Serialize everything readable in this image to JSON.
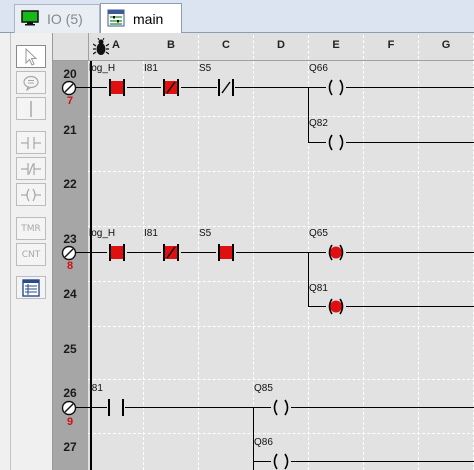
{
  "tabs": [
    {
      "label": "IO (5)",
      "icon": "monitor-icon",
      "active": false
    },
    {
      "label": "main",
      "icon": "ladder-diagram-icon",
      "active": true
    }
  ],
  "toolbox": [
    {
      "name": "pointer-tool",
      "icon": "arrow-pointer-icon"
    },
    {
      "name": "comment-tool",
      "icon": "speech-bubble-icon"
    },
    {
      "name": "wire-tool",
      "icon": "vertical-line-icon"
    },
    {
      "name": "contact-no-tool",
      "icon": "normally-open-contact-icon"
    },
    {
      "name": "contact-nc-tool",
      "icon": "normally-closed-contact-icon"
    },
    {
      "name": "coil-tool",
      "icon": "coil-icon"
    },
    {
      "name": "timer-tool",
      "label": "TMR"
    },
    {
      "name": "counter-tool",
      "label": "CNT"
    },
    {
      "name": "table-tool",
      "icon": "table-icon"
    }
  ],
  "columns": [
    "A",
    "B",
    "C",
    "D",
    "E",
    "F",
    "G"
  ],
  "bug_icon": "bug-icon",
  "rungs": [
    {
      "number": "20",
      "sub": "7",
      "timer_icon": "clock-icon"
    },
    {
      "number": "21"
    },
    {
      "number": "22"
    },
    {
      "number": "23",
      "sub": "8",
      "timer_icon": "clock-icon"
    },
    {
      "number": "24"
    },
    {
      "number": "25"
    },
    {
      "number": "26",
      "sub": "9",
      "timer_icon": "clock-icon"
    },
    {
      "number": "27"
    }
  ],
  "labels": {
    "r20_a": "log_H",
    "r20_b": "I81",
    "r20_c": "S5",
    "r20_e": "Q66",
    "r21_e": "Q82",
    "r23_a": "log_H",
    "r23_b": "I81",
    "r23_c": "S5",
    "r23_e": "Q65",
    "r24_e": "Q81",
    "r26_a": "I81",
    "r26_d": "Q85",
    "r27_d": "Q86"
  },
  "colors": {
    "active_red": "#e01010",
    "rung_counter": "#d01010",
    "rail_bar": "#a6a6a6",
    "ladder_bg": "#e2e2e2",
    "tab_bar": "#dbe4f0"
  }
}
